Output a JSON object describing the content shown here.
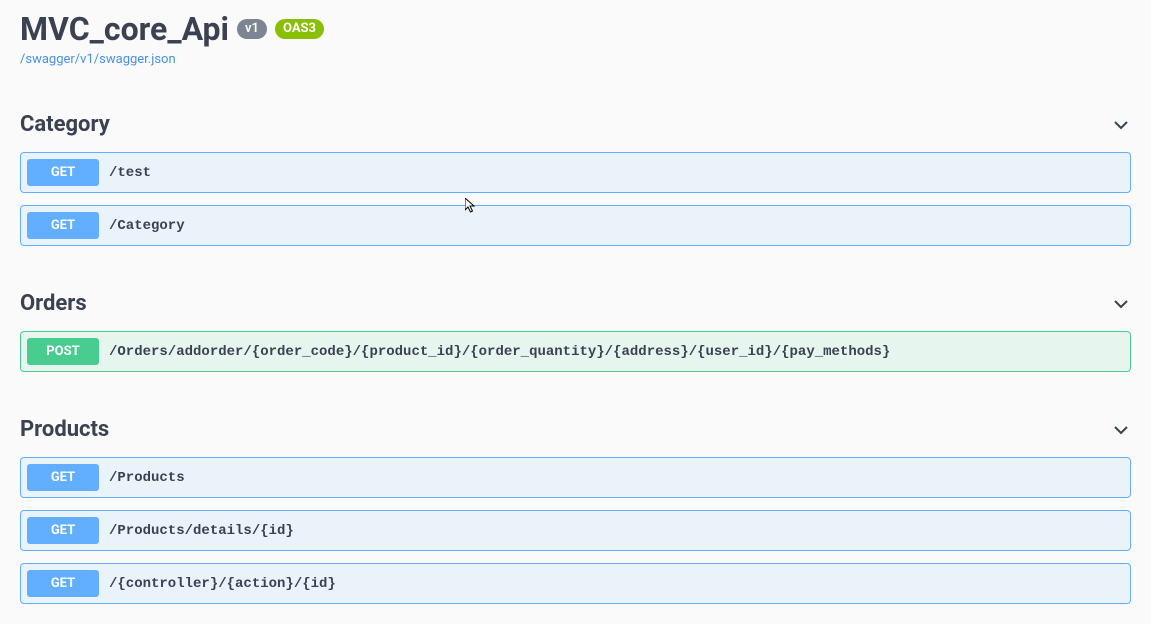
{
  "header": {
    "title": "MVC_core_Api",
    "version": "v1",
    "oas_label": "OAS3",
    "json_link": "/swagger/v1/swagger.json"
  },
  "tags": [
    {
      "name": "Category",
      "ops": [
        {
          "method": "GET",
          "method_class": "get",
          "path": "/test"
        },
        {
          "method": "GET",
          "method_class": "get",
          "path": "/Category"
        }
      ]
    },
    {
      "name": "Orders",
      "ops": [
        {
          "method": "POST",
          "method_class": "post",
          "path": "/Orders/addorder/{order_code}/{product_id}/{order_quantity}/{address}/{user_id}/{pay_methods}"
        }
      ]
    },
    {
      "name": "Products",
      "ops": [
        {
          "method": "GET",
          "method_class": "get",
          "path": "/Products"
        },
        {
          "method": "GET",
          "method_class": "get",
          "path": "/Products/details/{id}"
        },
        {
          "method": "GET",
          "method_class": "get",
          "path": "/{controller}/{action}/{id}"
        }
      ]
    }
  ]
}
